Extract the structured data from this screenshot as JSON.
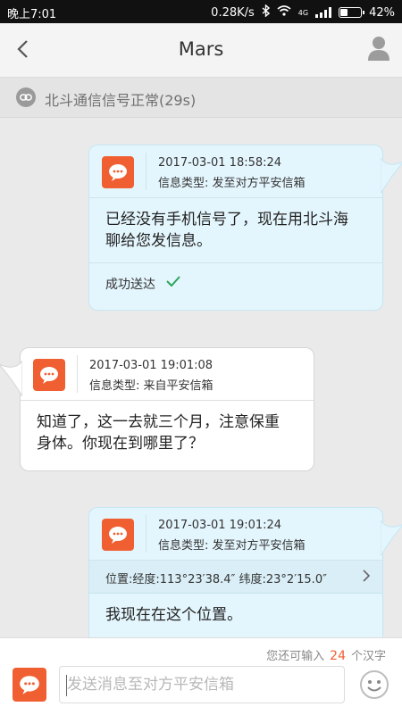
{
  "status_bar": {
    "time": "晚上7:01",
    "speed": "0.28K/s",
    "network": "4G",
    "battery": "42%",
    "battery_level": 0.42
  },
  "header": {
    "title": "Mars"
  },
  "signal_status": {
    "text": "北斗通信信号正常(29s)"
  },
  "messages": [
    {
      "direction": "outgoing",
      "timestamp": "2017-03-01 18:58:24",
      "type_label": "信息类型: 发至对方平安信箱",
      "line1": "已经没有手机信号了，现在用北斗海",
      "line2": "聊给您发信息。",
      "status": "成功送达"
    },
    {
      "direction": "incoming",
      "timestamp": "2017-03-01 19:01:08",
      "type_label": "信息类型: 来自平安信箱",
      "line1": "知道了，这一去就三个月，注意保重",
      "line2": "身体。你现在到哪里了？"
    },
    {
      "direction": "outgoing",
      "timestamp": "2017-03-01 19:01:24",
      "type_label": "信息类型: 发至对方平安信箱",
      "location": "位置:经度:113°23′38.4″  纬度:23°2′15.0″",
      "line1": "我现在在这个位置。"
    }
  ],
  "composer": {
    "counter_prefix": "您还可输入",
    "counter_value": "24",
    "counter_suffix": "个汉字",
    "placeholder": "发送消息至对方平安信箱"
  },
  "colors": {
    "accent": "#f05f32",
    "outgoing_bubble": "#e4f6fd",
    "success": "#2aa55a"
  }
}
